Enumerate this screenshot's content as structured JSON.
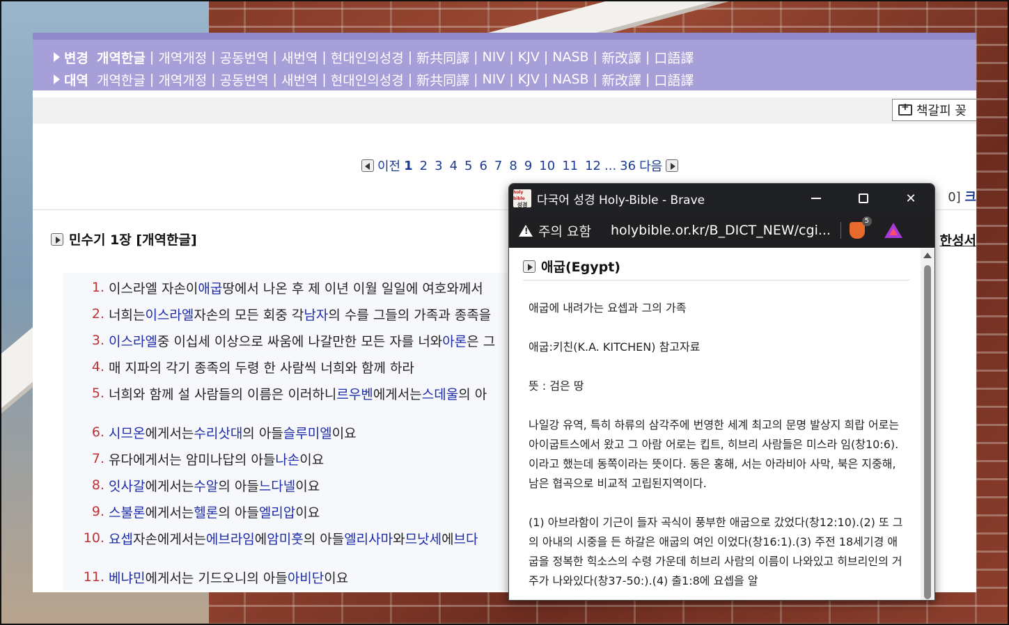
{
  "versions": {
    "row1": {
      "label": "변경",
      "items": [
        "개역한글",
        "개역개정",
        "공동번역",
        "새번역",
        "현대인의성경",
        "新共同譯",
        "NIV",
        "KJV",
        "NASB",
        "新改譯",
        "口語譯"
      ]
    },
    "row2": {
      "label": "대역",
      "items": [
        "개역한글",
        "개역개정",
        "공동번역",
        "새번역",
        "현대인의성경",
        "新共同譯",
        "NIV",
        "KJV",
        "NASB",
        "新改譯",
        "口語譯"
      ]
    }
  },
  "bookmark_button": "책갈피 꽂",
  "pager": {
    "prev": "이전",
    "pages": [
      "1",
      "2",
      "3",
      "4",
      "5",
      "6",
      "7",
      "8",
      "9",
      "10",
      "11",
      "12"
    ],
    "ellipsis": "...",
    "last": "36",
    "next": "다음"
  },
  "right_fragment_1": "0]",
  "right_fragment_1b": "크",
  "right_fragment_2": "한성서",
  "chapter_title": "민수기 1장 [개역한글]",
  "verses": [
    {
      "num": "1.",
      "parts": [
        [
          "이스라엘 자손이 ",
          0
        ],
        [
          "애굽",
          1
        ],
        [
          " 땅에서 나온 후 제 이년 이월 일일에 여호와께서 ",
          0
        ]
      ]
    },
    {
      "num": "2.",
      "parts": [
        [
          "너희는 ",
          0
        ],
        [
          "이스라엘",
          1
        ],
        [
          " 자손의 모든 회중 각 ",
          0
        ],
        [
          "남자",
          1
        ],
        [
          "의 수를 그들의 가족과 종족을",
          0
        ]
      ]
    },
    {
      "num": "3.",
      "parts": [
        [
          "이스라엘",
          1
        ],
        [
          " 중 이십세 이상으로 싸움에 나갈만한 모든 자를 너와 ",
          0
        ],
        [
          "아론",
          1
        ],
        [
          "은 그",
          0
        ]
      ]
    },
    {
      "num": "4.",
      "parts": [
        [
          "매 지파의 각기 종족의 두령 한 사람씩 너희와 함께 하라",
          0
        ]
      ]
    },
    {
      "num": "5.",
      "parts": [
        [
          "너희와 함께 설 사람들의 이름은 이러하니 ",
          0
        ],
        [
          "르우벤",
          1
        ],
        [
          "에게서는 ",
          0
        ],
        [
          "스데울",
          1
        ],
        [
          "의 아",
          0
        ]
      ]
    },
    {
      "num": "6.",
      "parts": [
        [
          "시므온",
          1
        ],
        [
          "에게서는 ",
          0
        ],
        [
          "수리삿대",
          1
        ],
        [
          "의 아들 ",
          0
        ],
        [
          "슬루미엘",
          1
        ],
        [
          "이요",
          0
        ]
      ]
    },
    {
      "num": "7.",
      "parts": [
        [
          "유다에게서는 암미나답의 아들 ",
          0
        ],
        [
          "나손",
          1
        ],
        [
          "이요",
          0
        ]
      ]
    },
    {
      "num": "8.",
      "parts": [
        [
          "잇사갈",
          1
        ],
        [
          "에게서는 ",
          0
        ],
        [
          "수알",
          1
        ],
        [
          "의 아들 ",
          0
        ],
        [
          "느다넬",
          1
        ],
        [
          "이요",
          0
        ]
      ]
    },
    {
      "num": "9.",
      "parts": [
        [
          "스불론",
          1
        ],
        [
          "에게서는 ",
          0
        ],
        [
          "헬론",
          1
        ],
        [
          "의 아들 ",
          0
        ],
        [
          "엘리압",
          1
        ],
        [
          "이요",
          0
        ]
      ]
    },
    {
      "num": "10.",
      "parts": [
        [
          "요셉",
          1
        ],
        [
          " 자손에게서는 ",
          0
        ],
        [
          "에브라임",
          1
        ],
        [
          "에 ",
          0
        ],
        [
          "암미훗",
          1
        ],
        [
          "의 아들 ",
          0
        ],
        [
          "엘리사마",
          1
        ],
        [
          "와 ",
          0
        ],
        [
          "므낫세",
          1
        ],
        [
          "에 ",
          0
        ],
        [
          "브다",
          1
        ]
      ]
    },
    {
      "num": "11.",
      "parts": [
        [
          "베냐민",
          1
        ],
        [
          "에게서는 기드오니의 아들 ",
          0
        ],
        [
          "아비단",
          1
        ],
        [
          "이요",
          0
        ]
      ]
    }
  ],
  "popup": {
    "favicon_top": "holy bible",
    "favicon_bottom": "성경",
    "window_title": "다국어 성경 Holy-Bible - Brave",
    "warning": "주의 요함",
    "url": "holybible.or.kr/B_DICT_NEW/cgi...",
    "badge_count": "5",
    "entry_title": "애굽(Egypt)",
    "paragraphs": [
      "애굽에 내려가는 요셉과 그의 가족",
      "애굽:키친(K.A. KITCHEN) 참고자료",
      "뜻 : 검은 땅",
      "나일강 유역, 특히 하류의 삼각주에 번영한 세계 최고의 문명 발상지 희랍 어로는 아이굽트스에서 왔고 그 아람 어로는 킵트, 히브리 사람들은 미스라 임(창10:6). 이라고 했는데 동쪽이라는 뜻이다. 동은 홍해, 서는 아라비아 사막, 북은 지중해, 남은 협곡으로 비교적 고립된지역이다.",
      "(1) 아브라함이 기근이 들자 곡식이 풍부한 애굽으로 갔었다(창12:10).(2) 또 그의 아내의 시중을 든 하갈은 애굽의 여인 이었다(창16:1).(3) 주전 18세기경 애굽을 정복한 힉소스의 수령 가운데 히브리 사람의 이름이 나와있고 히브리인의 거주가 나와있다(창37-50:).(4) 출1:8에 요셉을 알"
    ]
  },
  "colors": {
    "version_bar": "#a69fd8",
    "link": "#1a2aa8",
    "verse_num": "#b33333"
  }
}
